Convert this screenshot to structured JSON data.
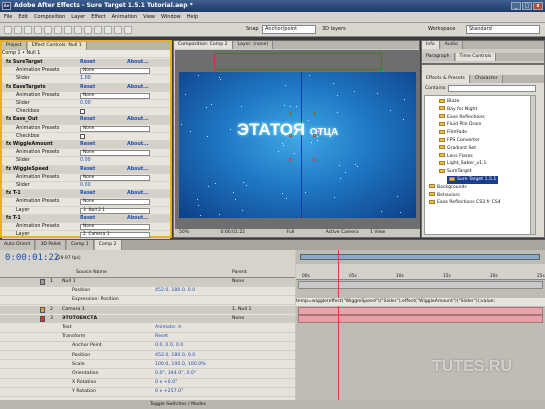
{
  "window": {
    "title": "Adobe After Effects - Sure Target 1.5.1 Tutorial.aep *",
    "logo": "Ae",
    "min": "_",
    "max": "□",
    "close": "x"
  },
  "menu": [
    "File",
    "Edit",
    "Composition",
    "Layer",
    "Effect",
    "Animation",
    "View",
    "Window",
    "Help"
  ],
  "toolbar": {
    "snap_label": "Snap",
    "snap_mode": "Anchor/point",
    "workspace_label": "Workspace",
    "workspace_value": "Standard",
    "layers_label": "3D layers"
  },
  "effect_controls": {
    "tabs": [
      "Project",
      "Effect Controls: Null 1"
    ],
    "header": "Comp 1 • Null 1",
    "rows": [
      {
        "type": "fx",
        "name": "fx SureTarget",
        "reset": "Reset",
        "about": "About..."
      },
      {
        "type": "drop",
        "name": "Animation Presets",
        "value": "None"
      },
      {
        "type": "val",
        "name": "Slider",
        "value": "1.00"
      },
      {
        "type": "fx",
        "name": "fx EaseTargets",
        "reset": "Reset",
        "about": "About..."
      },
      {
        "type": "drop",
        "name": "Animation Presets",
        "value": "None"
      },
      {
        "type": "val",
        "name": "Slider",
        "value": "0.00"
      },
      {
        "type": "chk",
        "name": "Checkbox",
        "value": ""
      },
      {
        "type": "fx",
        "name": "fx Ease_Out",
        "reset": "Reset",
        "about": "About..."
      },
      {
        "type": "drop",
        "name": "Animation Presets",
        "value": "None"
      },
      {
        "type": "chk",
        "name": "Checkbox",
        "value": ""
      },
      {
        "type": "fx",
        "name": "fx WiggleAmount",
        "reset": "Reset",
        "about": "About..."
      },
      {
        "type": "drop",
        "name": "Animation Presets",
        "value": "None"
      },
      {
        "type": "val",
        "name": "Slider",
        "value": "0.00"
      },
      {
        "type": "fx",
        "name": "fx WiggleSpeed",
        "reset": "Reset",
        "about": "About..."
      },
      {
        "type": "drop",
        "name": "Animation Presets",
        "value": "None"
      },
      {
        "type": "val",
        "name": "Slider",
        "value": "0.00"
      },
      {
        "type": "fx",
        "name": "fx T-1",
        "reset": "Reset",
        "about": "About..."
      },
      {
        "type": "drop",
        "name": "Animation Presets",
        "value": "None"
      },
      {
        "type": "drop",
        "name": "Layer",
        "value": "3. Null 2 1"
      },
      {
        "type": "fx",
        "name": "fx T-1",
        "reset": "Reset",
        "about": "About..."
      },
      {
        "type": "drop",
        "name": "Animation Presets",
        "value": "None"
      },
      {
        "type": "drop",
        "name": "Layer",
        "value": "2. Camera 1"
      }
    ]
  },
  "composition": {
    "tabs": [
      "Composition: Comp 2",
      "Layer: (none)"
    ],
    "text_main": "ЭТАТОЯ",
    "text_small": "ОТЦА",
    "zoom": "50%",
    "timecode": "0:00:01:22",
    "resolution": "Full",
    "camera": "Active Camera",
    "view": "1 View"
  },
  "right": {
    "top_tabs": [
      "Info",
      "Audio"
    ],
    "tabs2": [
      "Paragraph",
      "Time Controls"
    ],
    "tabs3": [
      "Effects & Presets",
      "Character"
    ],
    "contains_label": "Contains:",
    "items": [
      "Blaze",
      "Bay for Night",
      "Ease Reflections",
      "Fluid Pile Drain",
      "FilmFade",
      "FPS Converter",
      "Gradient Set",
      "Lens Flares",
      "Light_Saber_v1.1",
      "SureTarget",
      "Sure Target 1.5.1",
      "Backgrounds",
      "Behaviors",
      "Ease Reflections CS3 fr CS4"
    ]
  },
  "timeline": {
    "tabs": [
      "Auto Orient",
      "3D Pallet",
      "Comp 1",
      "Comp 2"
    ],
    "timecode": "0:00:01:22",
    "fps": "(29.97 fps)",
    "columns": {
      "source": "Source Name",
      "parent": "Parent"
    },
    "rows": [
      {
        "kind": "layer",
        "num": "1",
        "name": "Null 1",
        "value": "None"
      },
      {
        "kind": "prop",
        "name": "Position",
        "value": "452.0, 180.0, 0.0"
      },
      {
        "kind": "prop",
        "name": "Expression: Position",
        "value": ""
      },
      {
        "kind": "layer",
        "num": "2",
        "name": "Camera 1",
        "value": "1. Null 1"
      },
      {
        "kind": "layerred",
        "num": "3",
        "name": "ЭТОТОЕКСТА",
        "value": "None"
      },
      {
        "kind": "prop",
        "name": "Text",
        "value": "Animate: ⊙"
      },
      {
        "kind": "prop",
        "name": "Transform",
        "value": "Reset"
      },
      {
        "kind": "prop",
        "name": "Anchor Point",
        "value": "0.0, 0.0, 0.0"
      },
      {
        "kind": "prop",
        "name": "Position",
        "value": "452.0, 180.0, 0.0"
      },
      {
        "kind": "prop",
        "name": "Scale",
        "value": "100.0, 100.0, 100.0%"
      },
      {
        "kind": "prop",
        "name": "Orientation",
        "value": "0.0°, 344.0°, 0.0°"
      },
      {
        "kind": "prop",
        "name": "X Rotation",
        "value": "0 x +0.0°"
      },
      {
        "kind": "prop",
        "name": "Y Rotation",
        "value": "0 x +257.0°"
      }
    ],
    "ruler": [
      "00s",
      "05s",
      "10s",
      "15s",
      "20s",
      "25s"
    ],
    "expression": "temp=wiggle(effect(\"WiggleSpeed\")(\"Slider\"),effect(\"WiggleAmount\")(\"Slider\"));value;",
    "bottom": "Toggle Switches / Modes"
  },
  "watermark": "TUTES.RU",
  "colors": {
    "accent_border": "#e5b320",
    "timecode": "#1c4db0",
    "comp_blue": "#1f77c4",
    "playhead": "#e13b3b"
  }
}
